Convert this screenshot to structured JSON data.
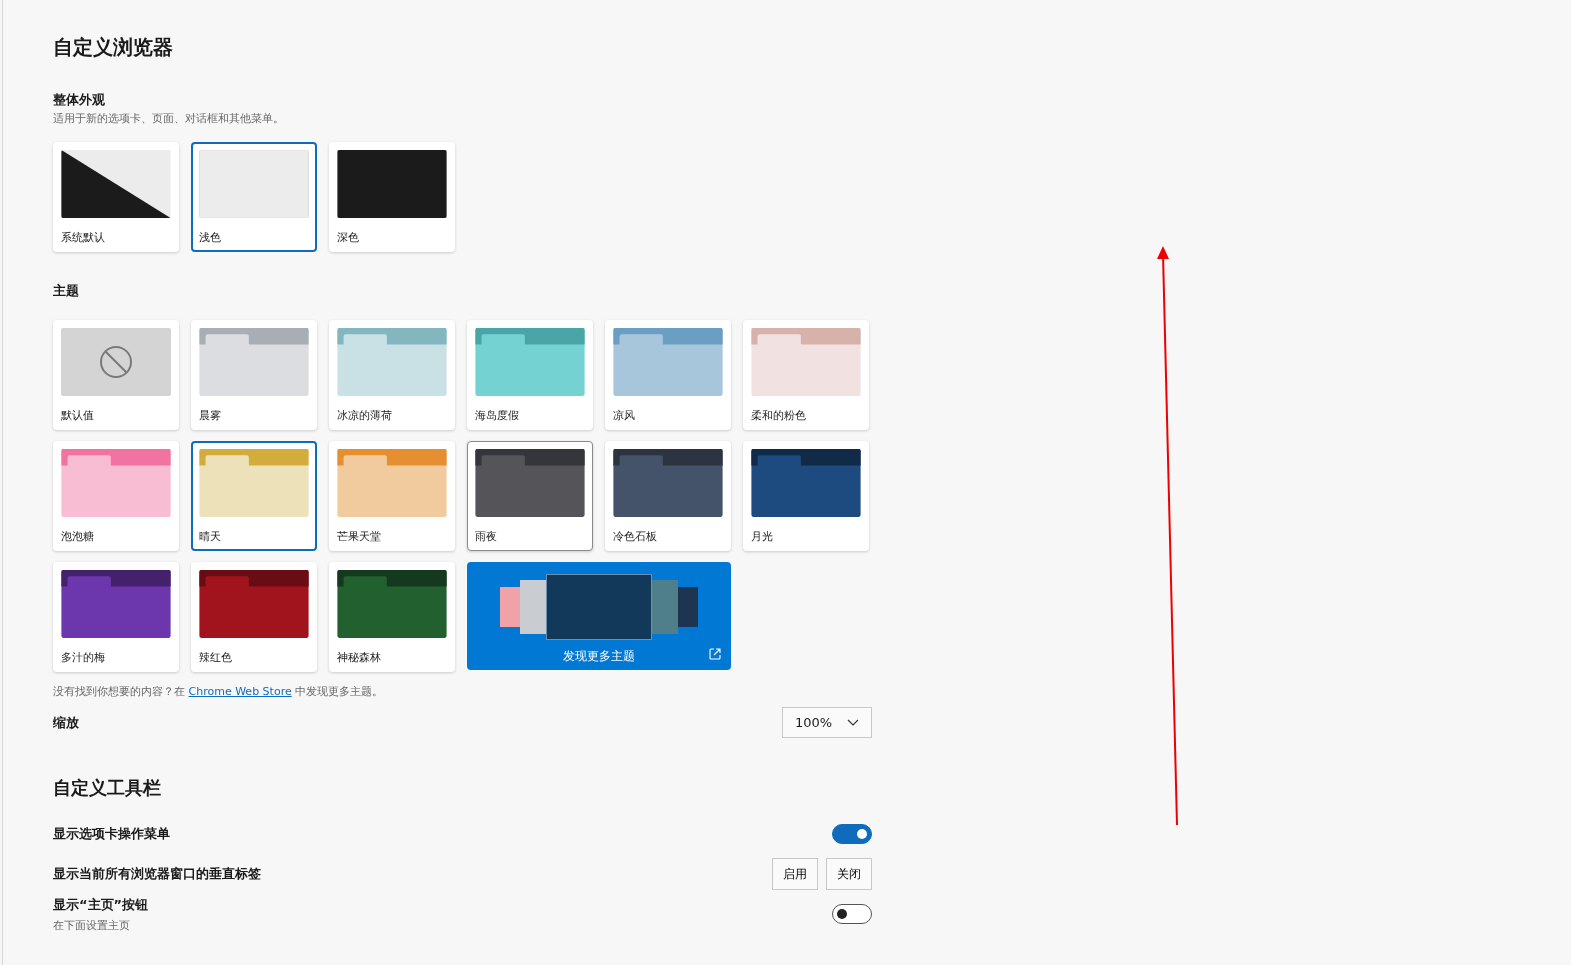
{
  "title": "自定义浏览器",
  "appearance": {
    "label": "整体外观",
    "description": "适用于新的选项卡、页面、对话框和其他菜单。",
    "options": [
      {
        "label": "系统默认",
        "kind": "system",
        "selected": false
      },
      {
        "label": "浅色",
        "kind": "light",
        "selected": true
      },
      {
        "label": "深色",
        "kind": "dark",
        "selected": false
      }
    ]
  },
  "themes": {
    "label": "主题",
    "items": [
      {
        "label": "默认值",
        "kind": "none",
        "selected": false,
        "hovered": false,
        "colors": [
          {
            "color": "#d4d4d4"
          }
        ]
      },
      {
        "label": "晨雾",
        "kind": "folder",
        "selected": false,
        "hovered": false,
        "colors": [
          {
            "color": "#a9adb4"
          },
          {
            "color": "#dcdde0"
          }
        ]
      },
      {
        "label": "冰凉的薄荷",
        "kind": "folder",
        "selected": false,
        "hovered": false,
        "colors": [
          {
            "color": "#84b6bf"
          },
          {
            "color": "#c9e0e5"
          }
        ]
      },
      {
        "label": "海岛度假",
        "kind": "folder",
        "selected": false,
        "hovered": false,
        "colors": [
          {
            "color": "#4aa6a6"
          },
          {
            "color": "#74d2d2"
          }
        ]
      },
      {
        "label": "凉风",
        "kind": "folder",
        "selected": false,
        "hovered": false,
        "colors": [
          {
            "color": "#6a9ec2"
          },
          {
            "color": "#a8c6db"
          }
        ]
      },
      {
        "label": "柔和的粉色",
        "kind": "folder",
        "selected": false,
        "hovered": false,
        "colors": [
          {
            "color": "#d6b2aa"
          },
          {
            "color": "#f1e1e0"
          }
        ]
      },
      {
        "label": "泡泡糖",
        "kind": "folder",
        "selected": false,
        "hovered": false,
        "colors": [
          {
            "color": "#f272a1"
          },
          {
            "color": "#f8bcd3"
          }
        ]
      },
      {
        "label": "晴天",
        "kind": "folder",
        "selected": true,
        "hovered": false,
        "colors": [
          {
            "color": "#d3ad3c"
          },
          {
            "color": "#ede1ba"
          }
        ]
      },
      {
        "label": "芒果天堂",
        "kind": "folder",
        "selected": false,
        "hovered": false,
        "colors": [
          {
            "color": "#e58f31"
          },
          {
            "color": "#f1cb9e"
          }
        ]
      },
      {
        "label": "雨夜",
        "kind": "folder",
        "selected": false,
        "hovered": true,
        "colors": [
          {
            "color": "#35363b"
          },
          {
            "color": "#545459"
          }
        ]
      },
      {
        "label": "冷色石板",
        "kind": "folder",
        "selected": false,
        "hovered": false,
        "colors": [
          {
            "color": "#2c3341"
          },
          {
            "color": "#44526a"
          }
        ]
      },
      {
        "label": "月光",
        "kind": "folder",
        "selected": false,
        "hovered": false,
        "colors": [
          {
            "color": "#112a47"
          },
          {
            "color": "#1d4b7f"
          }
        ]
      },
      {
        "label": "多汁的梅",
        "kind": "folder",
        "selected": false,
        "hovered": false,
        "colors": [
          {
            "color": "#44216d"
          },
          {
            "color": "#6c37ad"
          }
        ]
      },
      {
        "label": "辣红色",
        "kind": "folder",
        "selected": false,
        "hovered": false,
        "colors": [
          {
            "color": "#680d13"
          },
          {
            "color": "#a1141e"
          }
        ]
      },
      {
        "label": "神秘森林",
        "kind": "folder",
        "selected": false,
        "hovered": false,
        "colors": [
          {
            "color": "#15391e"
          },
          {
            "color": "#22602f"
          }
        ]
      },
      {
        "label": "发现更多主题",
        "kind": "discover"
      }
    ],
    "hint_before": "没有找到你想要的内容？在",
    "hint_link": "Chrome Web Store",
    "hint_after": "中发现更多主题。"
  },
  "zoom": {
    "label": "缩放",
    "value": "100%"
  },
  "toolbar": {
    "title": "自定义工具栏",
    "rows": [
      {
        "label": "显示选项卡操作菜单",
        "kind": "toggle",
        "on": true
      },
      {
        "label": "显示当前所有浏览器窗口的垂直标签",
        "kind": "buttons",
        "buttons": [
          "启用",
          "关闭"
        ]
      },
      {
        "label": "显示“主页”按钮",
        "kind": "toggle",
        "on": false,
        "description": "在下面设置主页"
      }
    ]
  }
}
